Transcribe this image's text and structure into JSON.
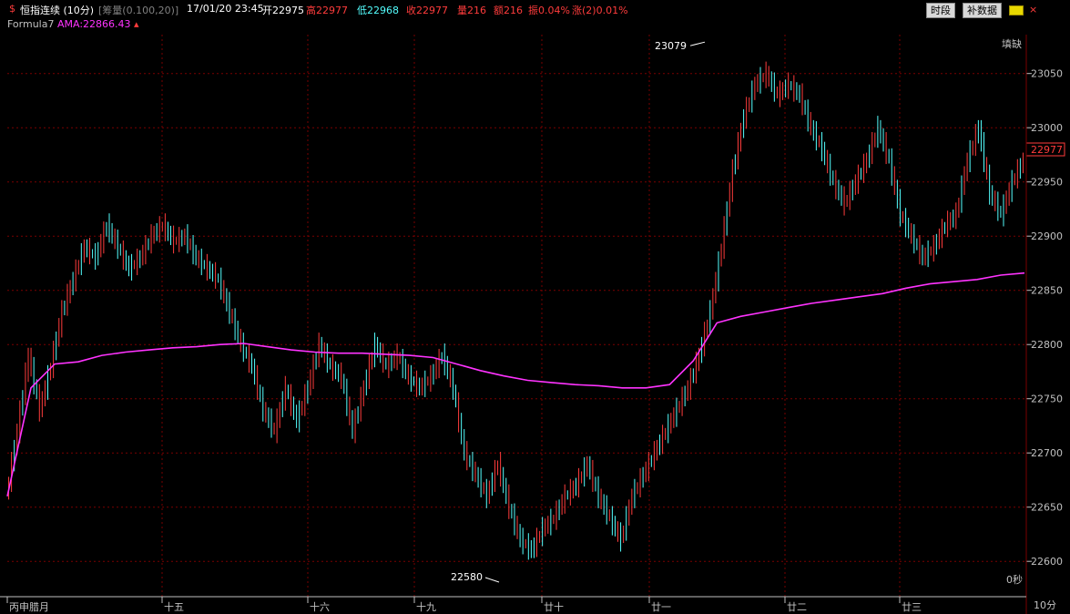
{
  "header": {
    "icon": "$",
    "title": "恒指连续 (10分)",
    "study": "[筹量(0.100,20)]",
    "datetime": "17/01/20 23:45",
    "open": "开22975",
    "high": "高22977",
    "low": "低22968",
    "close": "收22977",
    "volume": "量216",
    "amount": "额216",
    "amplitude": "振0.04%",
    "change": "涨(2)0.01%",
    "btn_period": "时段",
    "btn_supplement": "补数据",
    "btn_close": "×"
  },
  "formula": {
    "name": "Formula7",
    "ama_label": "AMA:22866.43"
  },
  "labels": {
    "fill_gap": "填缺",
    "seconds": "0秒",
    "period": "10分",
    "last_price": "22977"
  },
  "colors": {
    "up": "#ff3c3c",
    "down": "#54ffff",
    "ama": "#ff33ff",
    "grid": "#7a0000",
    "axis": "#c0c0c0"
  },
  "chart_data": {
    "type": "line",
    "title": "",
    "ylim": [
      22580,
      23080
    ],
    "yticks": [
      22600,
      22650,
      22700,
      22750,
      22800,
      22850,
      22900,
      22950,
      23000,
      23050
    ],
    "xticks": [
      "丙申腊月",
      "十五",
      "十六",
      "十九",
      "廿十",
      "廿一",
      "廿二",
      "廿三"
    ],
    "annotations": [
      {
        "text": "23079",
        "value": 23079
      },
      {
        "text": "22580",
        "value": 22580
      }
    ],
    "series": [
      {
        "name": "",
        "y": [
          22660,
          22720,
          22790,
          22740,
          22780,
          22830,
          22860,
          22890,
          22880,
          22910,
          22890,
          22870,
          22880,
          22900,
          22910,
          22895,
          22900,
          22880,
          22870,
          22860,
          22830,
          22800,
          22780,
          22740,
          22720,
          22760,
          22730,
          22760,
          22800,
          22780,
          22770,
          22720,
          22760,
          22800,
          22780,
          22790,
          22770,
          22760,
          22770,
          22790,
          22760,
          22700,
          22680,
          22660,
          22690,
          22650,
          22620,
          22610,
          22630,
          22640,
          22660,
          22670,
          22690,
          22660,
          22640,
          22620,
          22660,
          22680,
          22700,
          22720,
          22740,
          22760,
          22790,
          22830,
          22890,
          22960,
          23010,
          23040,
          23050,
          23030,
          23040,
          23030,
          23000,
          22980,
          22950,
          22930,
          22950,
          22970,
          23000,
          22970,
          22920,
          22900,
          22880,
          22890,
          22910,
          22920,
          22970,
          23000,
          22940,
          22920,
          22950,
          22970
        ]
      },
      {
        "name": "AMA",
        "y": [
          22660,
          22760,
          22782,
          22784,
          22790,
          22793,
          22795,
          22797,
          22798,
          22800,
          22801,
          22798,
          22795,
          22793,
          22792,
          22792,
          22791,
          22790,
          22788,
          22782,
          22776,
          22771,
          22767,
          22765,
          22763,
          22762,
          22760,
          22760,
          22763,
          22785,
          22820,
          22826,
          22830,
          22834,
          22838,
          22841,
          22844,
          22847,
          22852,
          22856,
          22858,
          22860,
          22864,
          22866
        ]
      }
    ]
  }
}
